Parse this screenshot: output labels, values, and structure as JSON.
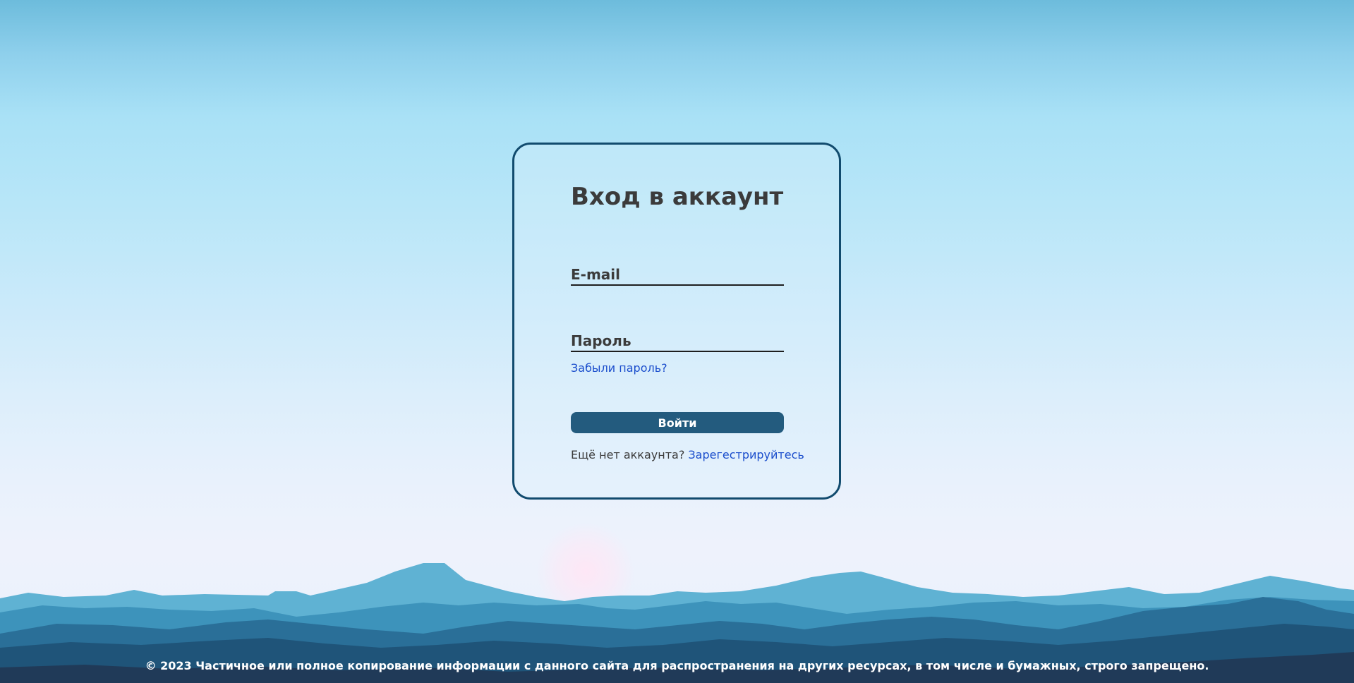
{
  "login": {
    "title": "Вход в аккаунт",
    "email_label": "E-mail",
    "password_label": "Пароль",
    "forgot_link": "Забыли пароль?",
    "submit_label": "Войти",
    "register_prompt": "Ещё нет аккаунта?",
    "register_link": "Зарегестрируйтесь"
  },
  "footer": {
    "copyright": "© 2023 Частичное или полное копирование информации с данного сайта для распространения на других ресурсах, в том числе и бумажных, строго запрещено."
  },
  "colors": {
    "card_border": "#114b6e",
    "button": "#235b7e",
    "link": "#1a4dcc",
    "text": "#3b3b3b"
  }
}
